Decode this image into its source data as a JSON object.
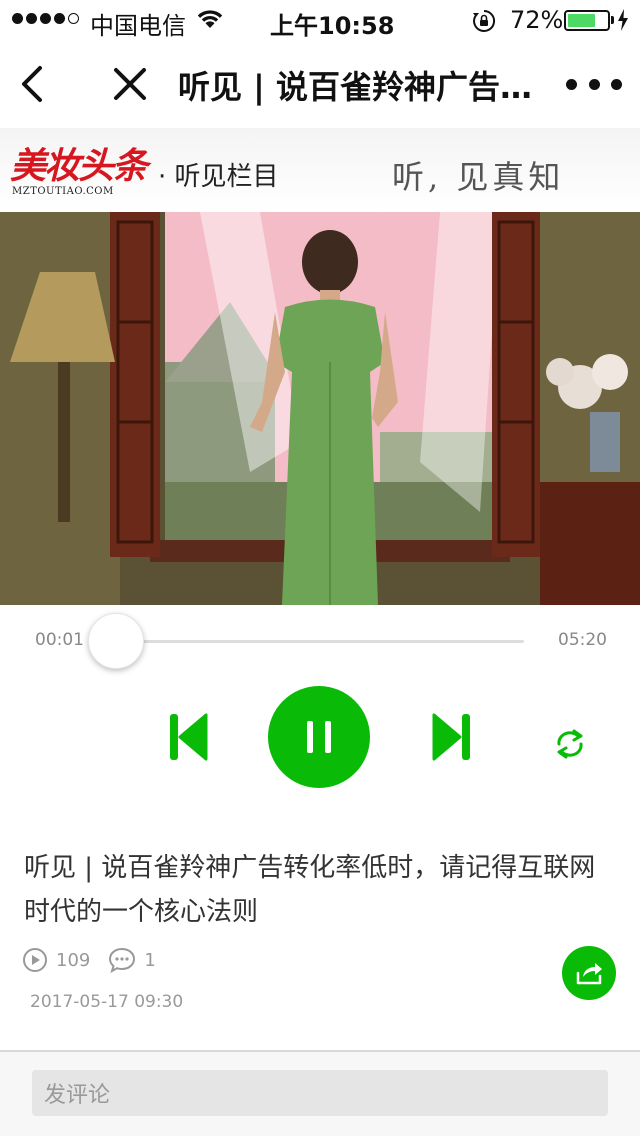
{
  "status_bar": {
    "carrier": "中国电信",
    "time": "上午10:58",
    "battery_percent": "72%",
    "battery_level": 0.72,
    "signal_strength": 4,
    "battery_color": "#4cd964"
  },
  "nav": {
    "title": "听见 | 说百雀羚神广告转化率低时，请记得互联网时代的一个核心法则",
    "icons": [
      "back-icon",
      "close-icon",
      "more-icon"
    ]
  },
  "banner": {
    "logo_text": "美妆头条",
    "logo_sub": "MZTOUTIAO.COM",
    "column": "· 听见栏目",
    "slogan": "听, 见真知",
    "brand_color": "#d6171f"
  },
  "player": {
    "current_time": "00:01",
    "total_time": "05:20",
    "progress": 0.003,
    "state": "playing",
    "accent_color": "#09bb07",
    "icons": [
      "prev-icon",
      "pause-icon",
      "next-icon",
      "loop-icon"
    ]
  },
  "article": {
    "title": "听见 | 说百雀羚神广告转化率低时，请记得互联网时代的一个核心法则",
    "plays": "109",
    "comments": "1",
    "date": "2017-05-17 09:30"
  },
  "comment": {
    "placeholder": "发评论"
  }
}
